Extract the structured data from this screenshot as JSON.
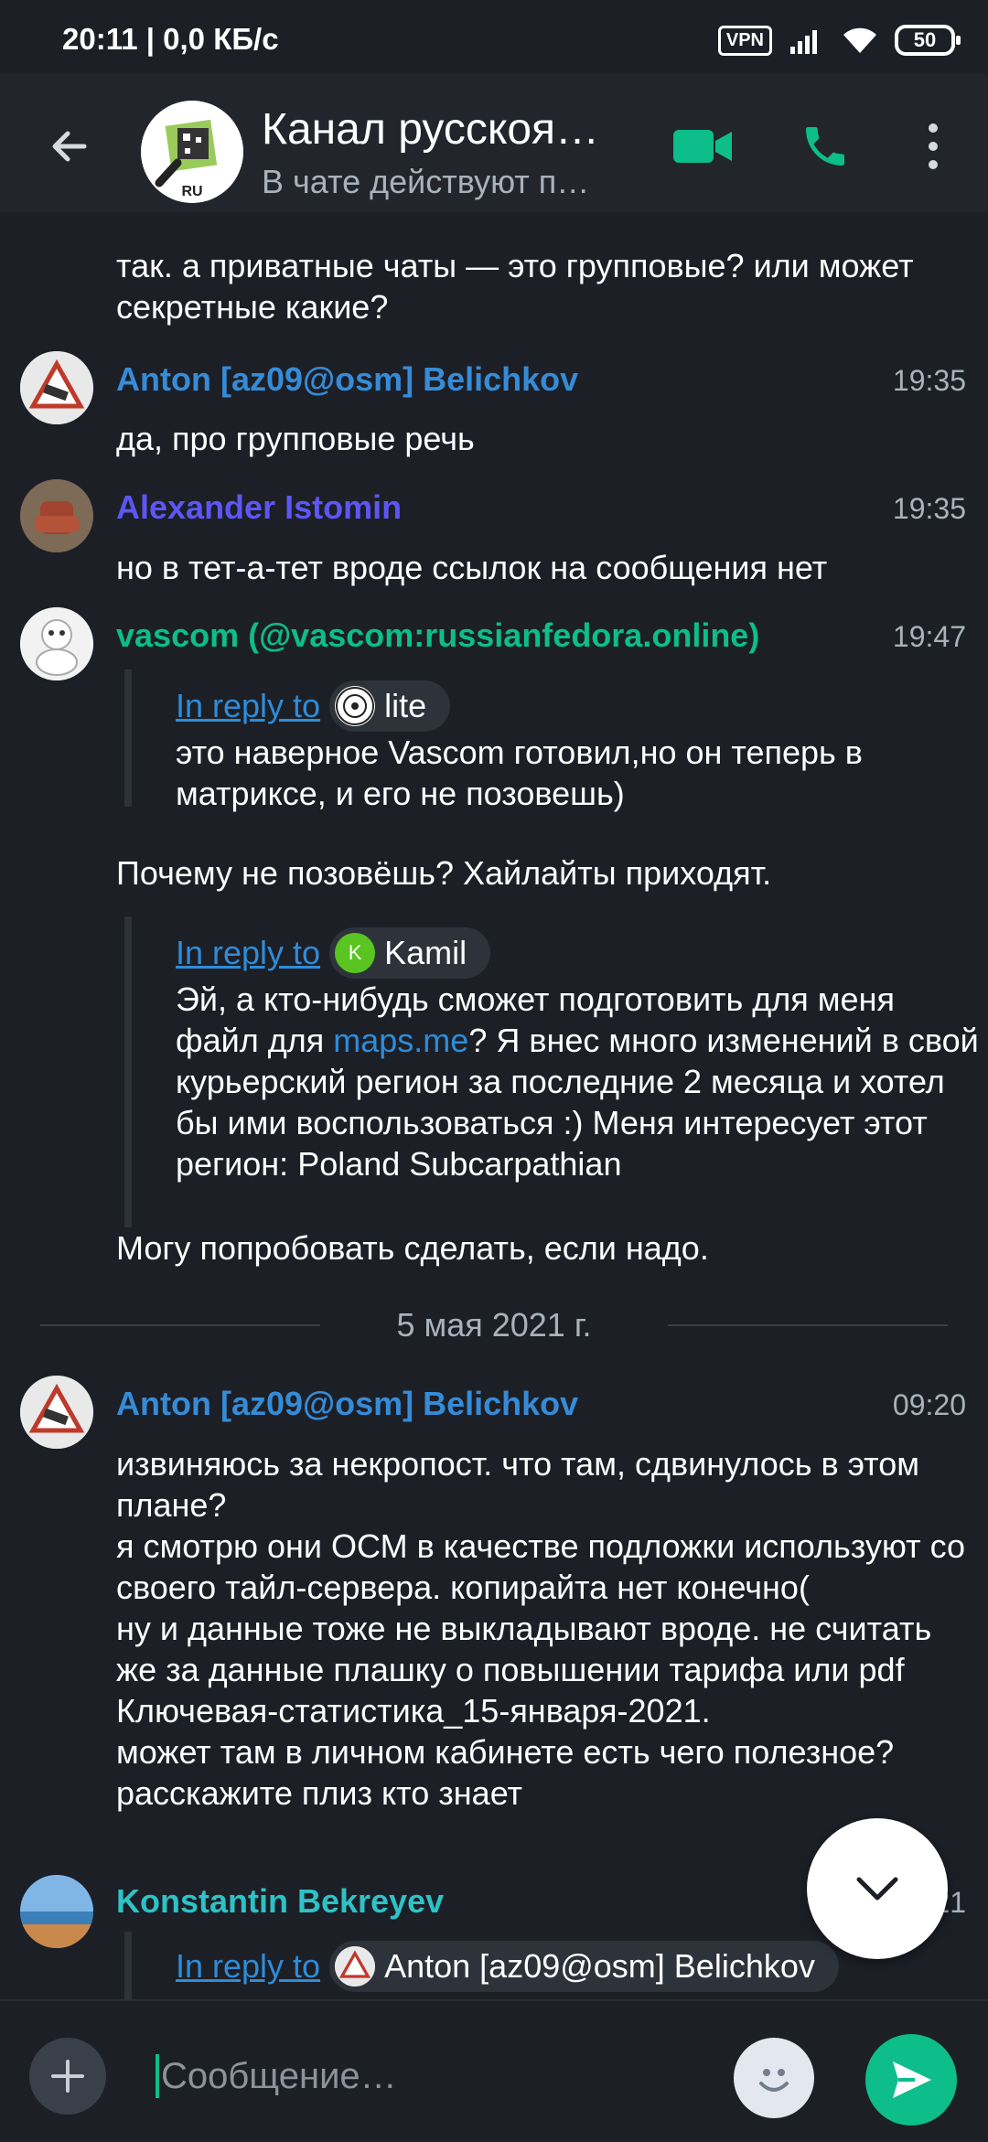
{
  "status_bar": {
    "time": "20:11 | 0,0 КБ/с",
    "vpn": "VPN",
    "battery": "50"
  },
  "header": {
    "title": "Канал русскоя…",
    "topic": "В чате действуют п…",
    "avatar_text": "RU"
  },
  "timeline": {
    "partial_message": "так. а приватные чаты — это групповые? или может секретные какие?",
    "messages": [
      {
        "sender": "Anton [az09@osm] Belichkov",
        "time": "19:35",
        "text": "да, про групповые речь",
        "color": "#368bd6"
      },
      {
        "sender": "Alexander Istomin",
        "time": "19:35",
        "text": "но в тет-а-тет вроде ссылок на сообщения нет",
        "color": "#5c56f5"
      },
      {
        "sender": "vascom (@vascom:russianfedora.online)",
        "time": "19:47",
        "color": "#0dbd8b",
        "reply1": {
          "link": "In reply to",
          "user": "lite",
          "text": "это наверное Vascom готовил,но он теперь в матриксе, и его не позовешь)"
        },
        "text1": "Почему не позовёшь? Хайлайты приходят.",
        "reply2": {
          "link": "In reply to",
          "user": "Kamil",
          "avatar_letter": "K",
          "text_before": "Эй, а кто-нибудь сможет подготовить для меня файл для ",
          "link_text": "maps.me",
          "text_after": "? Я внес много изменений в свой курьерский регион за последние 2 месяца и хотел бы ими воспользоваться :) Меня интересует этот регион: Poland Subcarpathian"
        },
        "text2": "Могу попробовать сделать, если надо."
      },
      {
        "sender": "Anton [az09@osm] Belichkov",
        "time": "09:20",
        "color": "#368bd6",
        "text": "извиняюсь за некропост. что там, сдвинулось в этом плане?\nя смотрю они ОСМ в качестве подложки используют со своего тайл-сервера. копирайта нет конечно(\nну и данные тоже не выкладывают вроде. не считать же за данные плашку о повышении тарифа или pdf Ключевая-статистика_15-января-2021.\nможет там в личном кабинете есть чего полезное? расскажите плиз кто знает"
      },
      {
        "sender": "Konstantin Bekreyev",
        "time": "21",
        "color": "#2dc2c5",
        "reply": {
          "link": "In reply to",
          "user": "Anton [az09@osm] Belichkov"
        }
      }
    ],
    "date_separator": "5 мая 2021 г."
  },
  "composer": {
    "placeholder": "Сообщение…"
  },
  "colors": {
    "background": "#1c1f26",
    "header": "#22252c",
    "accent": "#0dbd8b",
    "link": "#2f8cd8"
  }
}
